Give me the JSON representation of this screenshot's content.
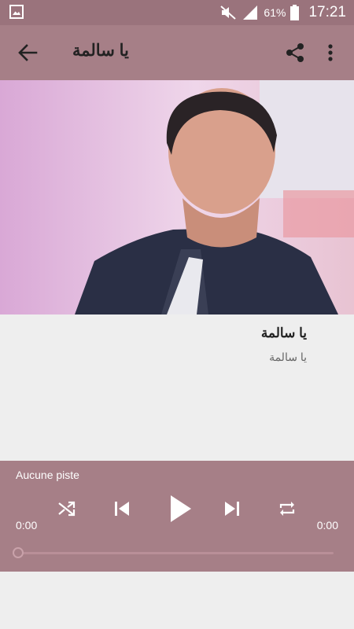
{
  "status_bar": {
    "battery_percent": "61%",
    "clock": "17:21",
    "icons": [
      "gallery-icon",
      "mute-icon",
      "signal-icon",
      "battery-icon"
    ]
  },
  "toolbar": {
    "title": "يا سالمة",
    "icons": [
      "back-arrow-icon",
      "share-icon",
      "more-vert-icon"
    ]
  },
  "track": {
    "title": "يا سالمة",
    "artist": "يا سالمة"
  },
  "player": {
    "now_playing": "Aucune piste",
    "elapsed": "0:00",
    "total": "0:00",
    "progress": 0,
    "controls": [
      "shuffle-icon",
      "skip-previous-icon",
      "play-icon",
      "skip-next-icon",
      "repeat-icon"
    ]
  },
  "colors": {
    "status_bar": "#9a737c",
    "accent": "#a67f87",
    "background": "#eeeeee"
  }
}
